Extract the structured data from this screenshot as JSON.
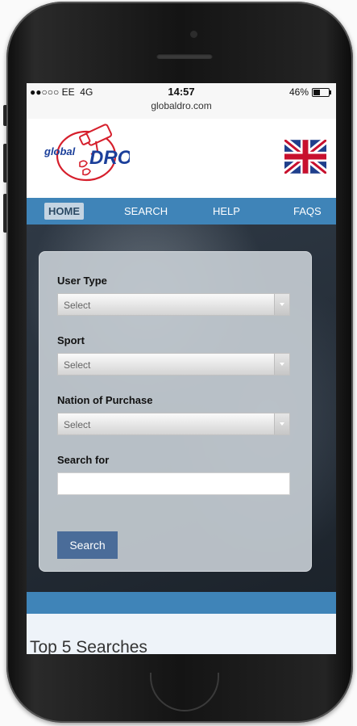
{
  "statusbar": {
    "carrier": "EE",
    "network": "4G",
    "time": "14:57",
    "url": "globaldro.com",
    "battery": "46%",
    "battery_level": 0.46
  },
  "logo": {
    "word_global": "global",
    "word_dro": "DRO"
  },
  "nav": {
    "items": [
      {
        "label": "HOME",
        "active": true
      },
      {
        "label": "SEARCH",
        "active": false
      },
      {
        "label": "HELP",
        "active": false
      },
      {
        "label": "FAQS",
        "active": false
      }
    ]
  },
  "form": {
    "user_type": {
      "label": "User Type",
      "value": "Select"
    },
    "sport": {
      "label": "Sport",
      "value": "Select"
    },
    "nation": {
      "label": "Nation of Purchase",
      "value": "Select"
    },
    "search_for": {
      "label": "Search for",
      "value": ""
    },
    "search_button": "Search"
  },
  "section": {
    "title": "Top 5 Searches"
  },
  "colors": {
    "brand_blue": "#3f84b8",
    "button_blue": "#4a6c99",
    "logo_red": "#d61f2c",
    "logo_blue": "#1b3f9a"
  }
}
